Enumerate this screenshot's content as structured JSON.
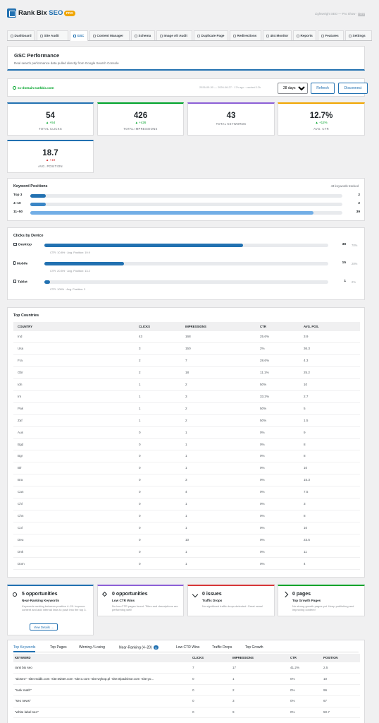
{
  "app": {
    "brand_main": "Rank Bix ",
    "brand_accent": "SEO",
    "badge": "PRO",
    "version_text": "Lightweight SEO — Pro Show",
    "docs_link": "Docs"
  },
  "nav": [
    {
      "label": "Dashboard"
    },
    {
      "label": "Site Audit"
    },
    {
      "label": "GSC"
    },
    {
      "label": "Content Manager"
    },
    {
      "label": "Schema"
    },
    {
      "label": "Image Alt Audit"
    },
    {
      "label": "Duplicate Page"
    },
    {
      "label": "Redirections"
    },
    {
      "label": "404 Monitor"
    },
    {
      "label": "Reports"
    },
    {
      "label": "Features"
    },
    {
      "label": "Settings"
    }
  ],
  "gsc": {
    "title": "GSC Performance",
    "subtitle": "Real search performance data pulled directly from Google Search Console"
  },
  "connection": {
    "domain": "sc-domain:rankbix.com",
    "date_range": "2026-05-30 — 2026-06-27 · 17h ago · cached 12h",
    "period": "28 days",
    "period_options": [
      "7 days",
      "28 days",
      "90 days"
    ],
    "refresh": "Refresh",
    "disconnect": "Disconnect"
  },
  "stats": [
    {
      "value": "54",
      "delta": "▲ +54",
      "label": "TOTAL CLICKS",
      "color": "#2271b1"
    },
    {
      "value": "426",
      "delta": "▲ +426",
      "label": "TOTAL IMPRESSIONS",
      "color": "#00a32a"
    },
    {
      "value": "43",
      "delta": "",
      "label": "TOTAL KEYWORDS",
      "color": "#8c5fd6"
    },
    {
      "value": "12.7%",
      "delta": "▲ +12%",
      "label": "AVG. CTR",
      "color": "#f0a500"
    },
    {
      "value": "18.7",
      "delta": "▲ +18",
      "label": "AVG. POSITION",
      "color": "#2271b1"
    }
  ],
  "keyword_positions": {
    "title": "Keyword Positions",
    "tracked": "43 keywords tracked",
    "rows": [
      {
        "label": "Top 3",
        "value": "2",
        "fraction": 0.05,
        "color": "#2271b1"
      },
      {
        "label": "4–10",
        "value": "2",
        "fraction": 0.05,
        "color": "#3b86c6"
      },
      {
        "label": "11–50",
        "value": "39",
        "fraction": 0.907,
        "color": "#72aee6"
      }
    ]
  },
  "devices": {
    "title": "Clicks by Device",
    "rows": [
      {
        "label": "Desktop",
        "value": "38",
        "pct": "70%",
        "fraction": 0.7,
        "sub": "CTR: 10.8%  ·  Avg. Position: 19.9",
        "color": "#2271b1"
      },
      {
        "label": "Mobile",
        "value": "15",
        "pct": "28%",
        "fraction": 0.28,
        "sub": "CTR: 20.5%  ·  Avg. Position: 13.2",
        "color": "#2271b1"
      },
      {
        "label": "Tablet",
        "value": "1",
        "pct": "2%",
        "fraction": 0.02,
        "sub": "CTR: 100%  ·  Avg. Position: 2",
        "color": "#2271b1"
      }
    ]
  },
  "countries": {
    "title": "Top Countries",
    "headers": [
      "COUNTRY",
      "CLICKS",
      "IMPRESSIONS",
      "CTR",
      "AVG. POS."
    ],
    "rows": [
      [
        "Ind",
        "43",
        "168",
        "25.6%",
        "3.9"
      ],
      [
        "Usa",
        "3",
        "150",
        "2%",
        "36.3"
      ],
      [
        "Fra",
        "2",
        "7",
        "28.6%",
        "4.3"
      ],
      [
        "Gbr",
        "2",
        "18",
        "11.1%",
        "25.2"
      ],
      [
        "Idn",
        "1",
        "2",
        "50%",
        "10"
      ],
      [
        "Irn",
        "1",
        "3",
        "33.3%",
        "2.7"
      ],
      [
        "Pak",
        "1",
        "2",
        "50%",
        "5"
      ],
      [
        "Zaf",
        "1",
        "2",
        "50%",
        "1.5"
      ],
      [
        "Aus",
        "0",
        "1",
        "0%",
        "9"
      ],
      [
        "Bgd",
        "0",
        "1",
        "0%",
        "8"
      ],
      [
        "Bgr",
        "0",
        "1",
        "0%",
        "8"
      ],
      [
        "Blr",
        "0",
        "1",
        "0%",
        "10"
      ],
      [
        "Bra",
        "0",
        "3",
        "0%",
        "15.3"
      ],
      [
        "Can",
        "0",
        "4",
        "0%",
        "7.5"
      ],
      [
        "Chl",
        "0",
        "1",
        "0%",
        "3"
      ],
      [
        "Chn",
        "0",
        "1",
        "0%",
        "8"
      ],
      [
        "Col",
        "0",
        "1",
        "0%",
        "10"
      ],
      [
        "Deu",
        "0",
        "10",
        "0%",
        "23.5"
      ],
      [
        "Dnk",
        "0",
        "1",
        "0%",
        "11"
      ],
      [
        "Dom",
        "0",
        "1",
        "0%",
        "4"
      ]
    ]
  },
  "opportunities": [
    {
      "title": "5 opportunities",
      "subtitle": "Near-Ranking Keywords",
      "desc": "Keywords ranking between position 4–20. Improve content and add internal links to push into the top 3.",
      "button": "View Details →",
      "color": "#2271b1",
      "sub_color": "#1d2327"
    },
    {
      "title": "0 opportunities",
      "subtitle": "Low CTR Wins",
      "desc": "No low-CTR pages found. Titles and descriptions are performing well!",
      "button": "",
      "color": "#8c5fd6",
      "sub_color": "#1d2327"
    },
    {
      "title": "0 issues",
      "subtitle": "Traffic Drops",
      "desc": "No significant traffic drops detected. Great news!",
      "button": "",
      "color": "#d63638",
      "sub_color": "#1d2327"
    },
    {
      "title": "0 pages",
      "subtitle": "Top Growth Pages",
      "desc": "No strong growth pages yet. Keep publishing and improving content!",
      "button": "",
      "color": "#00a32a",
      "sub_color": "#1d2327"
    }
  ],
  "keywords": {
    "tabs": [
      {
        "label": "Top Keywords"
      },
      {
        "label": "Top Pages"
      },
      {
        "label": "Winning / Losing"
      },
      {
        "label": "Near-Ranking (4–20)",
        "badge": "5"
      },
      {
        "label": "Low CTR Wins"
      },
      {
        "label": "Traffic Drops"
      },
      {
        "label": "Top Growth"
      }
    ],
    "headers": [
      "KEYWORD",
      "CLICKS",
      "IMPRESSIONS",
      "CTR",
      "POSITION"
    ],
    "rows": [
      [
        "rank bix seo",
        "7",
        "17",
        "41.2%",
        "2.5"
      ],
      [
        "\"aioseo\" -site:reddit.com -site:twitter.com -site:x.com -site:wykop.pl -site:tripadvisor.com -site:yo...",
        "0",
        "1",
        "0%",
        "10"
      ],
      [
        "\"rank math\"",
        "0",
        "2",
        "0%",
        "96"
      ],
      [
        "\"seo news\"",
        "0",
        "3",
        "0%",
        "67"
      ],
      [
        "\"white label seo\"",
        "0",
        "9",
        "0%",
        "50.7"
      ]
    ]
  }
}
